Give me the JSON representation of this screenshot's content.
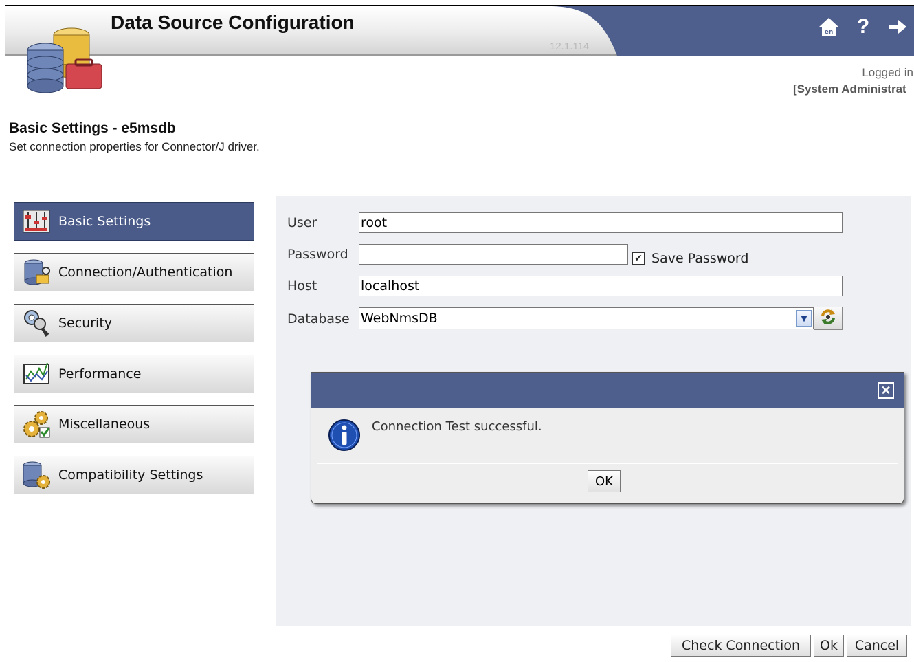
{
  "header": {
    "title": "Data Source Configuration",
    "version": "12.1.114",
    "icons": [
      "home-icon",
      "help-icon",
      "logout-icon"
    ],
    "home_icon_text": "en"
  },
  "session": {
    "logged_in_label": "Logged in",
    "role": "[System Administrat"
  },
  "page": {
    "title": "Basic Settings - e5msdb",
    "subtitle": "Set connection properties for Connector/J driver."
  },
  "sidebar": {
    "items": [
      {
        "label": "Basic Settings",
        "icon": "sliders-icon",
        "active": true
      },
      {
        "label": "Connection/Authentication",
        "icon": "database-key-icon",
        "active": false
      },
      {
        "label": "Security",
        "icon": "keys-icon",
        "active": false
      },
      {
        "label": "Performance",
        "icon": "chart-icon",
        "active": false
      },
      {
        "label": "Miscellaneous",
        "icon": "gears-icon",
        "active": false
      },
      {
        "label": "Compatibility Settings",
        "icon": "database-gear-icon",
        "active": false
      }
    ]
  },
  "form": {
    "user_label": "User",
    "user_value": "root",
    "password_label": "Password",
    "password_value": "",
    "save_password_label": "Save Password",
    "save_password_checked": true,
    "host_label": "Host",
    "host_value": "localhost",
    "database_label": "Database",
    "database_value": "WebNmsDB"
  },
  "dialog": {
    "message": "Connection Test successful.",
    "ok_label": "OK",
    "icon": "info-icon"
  },
  "footer": {
    "check_connection_label": "Check Connection",
    "ok_label": "Ok",
    "cancel_label": "Cancel"
  },
  "colors": {
    "accent": "#4e5f8e",
    "active_sidebar": "#4a5b8a",
    "panel_bg": "#eef0f4"
  }
}
